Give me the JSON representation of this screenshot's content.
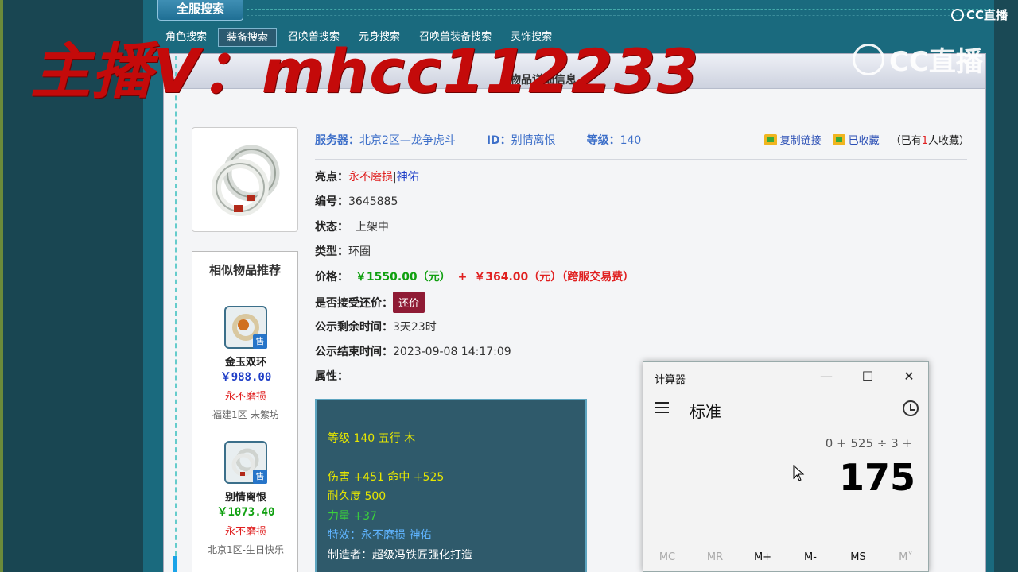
{
  "app": {
    "top_tab": "全服搜索",
    "nav": [
      "角色搜索",
      "装备搜索",
      "召唤兽搜索",
      "元身搜索",
      "召唤兽装备搜索",
      "灵饰搜索"
    ],
    "active_nav": 1,
    "panel_title": "物品详细信息"
  },
  "watermark": "主播V：mhcc112233",
  "logos": {
    "small": "CC直播",
    "big": "CC直播"
  },
  "item": {
    "server_label": "服务器：",
    "server": "北京2区—龙争虎斗",
    "id_label": "ID：",
    "id": "别情离恨",
    "level_label": "等级：",
    "level": "140",
    "copy_link": "复制链接",
    "favorited": "已收藏",
    "fav_count_prefix": "（已有",
    "fav_count": "1",
    "fav_count_suffix": "人收藏）",
    "highlight_label": "亮点：",
    "highlight_1": "永不磨损",
    "highlight_sep": "|",
    "highlight_2": "神佑",
    "number_label": "编号：",
    "number": "3645885",
    "status_label": "状态：",
    "status": "上架中",
    "type_label": "类型：",
    "type": "环圈",
    "price_label": "价格：",
    "price": "￥1550.00（元）",
    "plus": "+",
    "fee": "￥364.00（元）（跨服交易费）",
    "counter_label": "是否接受还价：",
    "counter_button": "还价",
    "remain_label": "公示剩余时间：",
    "remain": "3天23时",
    "end_label": "公示结束时间：",
    "end": "2023-09-08 14:17:09",
    "attr_label": "属性："
  },
  "attributes": {
    "line1": "等级 140 五行 木",
    "line2": "伤害 +451 命中 +525",
    "line3": "耐久度 500",
    "line4": "力量 +37",
    "line5": "特效：永不磨损 神佑",
    "line6": "制造者：超级冯铁匠强化打造"
  },
  "similar": {
    "title": "相似物品推荐",
    "sale_badge": "售",
    "items": [
      {
        "name": "金玉双环",
        "price": "￥988.00",
        "tag": "永不磨损",
        "server": "福建1区-未紫坊",
        "price_color": "#1f3ec7"
      },
      {
        "name": "别情离恨",
        "price": "￥1073.40",
        "tag": "永不磨损",
        "server": "北京1区-生日快乐",
        "price_color": "#10a010"
      }
    ]
  },
  "calculator": {
    "title": "计算器",
    "mode": "标准",
    "expression": "0 + 525 ÷ 3 +",
    "display": "175",
    "memory": [
      "MC",
      "MR",
      "M+",
      "M-",
      "MS",
      "M˅"
    ],
    "win_min": "—",
    "win_max": "☐",
    "win_close": "✕"
  }
}
